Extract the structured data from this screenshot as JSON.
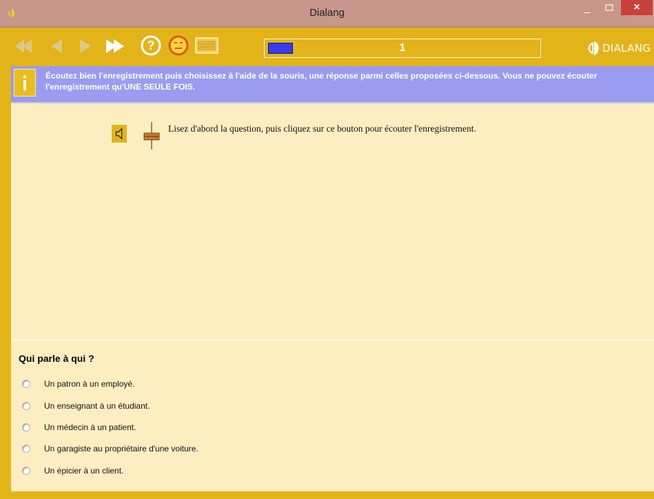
{
  "window": {
    "title": "Dialang",
    "minimize_label": "_",
    "close_label": "×"
  },
  "toolbar": {
    "buttons": [
      "first-icon",
      "back-icon",
      "forward-icon",
      "fast-forward-icon",
      "help-icon",
      "neutral-face-icon",
      "keyboard-icon"
    ],
    "progress_value": 1,
    "progress_label": "1",
    "logo_text": "DIALANG"
  },
  "instruction": {
    "text": "Écoutez bien l'enregistrement puis choisissez à l'aide de la souris, une réponse parmi celles proposées ci-dessous. Vous ne pouvez écouter l'enregistrement qu'UNE SEULE FOIS."
  },
  "task": {
    "listen_text": "Lisez d'abord la question, puis cliquez sur ce bouton pour écouter l'enregistrement."
  },
  "question": {
    "title": "Qui parle à qui ?",
    "options": [
      "Un patron à un employé.",
      "Un enseignant à un étudiant.",
      "Un médecin à un patient.",
      "Un garagiste au propriétaire d'une voiture.",
      "Un épicier à un client."
    ]
  },
  "colors": {
    "toolbar": "#e2b41a",
    "banner": "#9b9bf2",
    "panel": "#fdeec1",
    "titlebar": "#c8968a"
  }
}
